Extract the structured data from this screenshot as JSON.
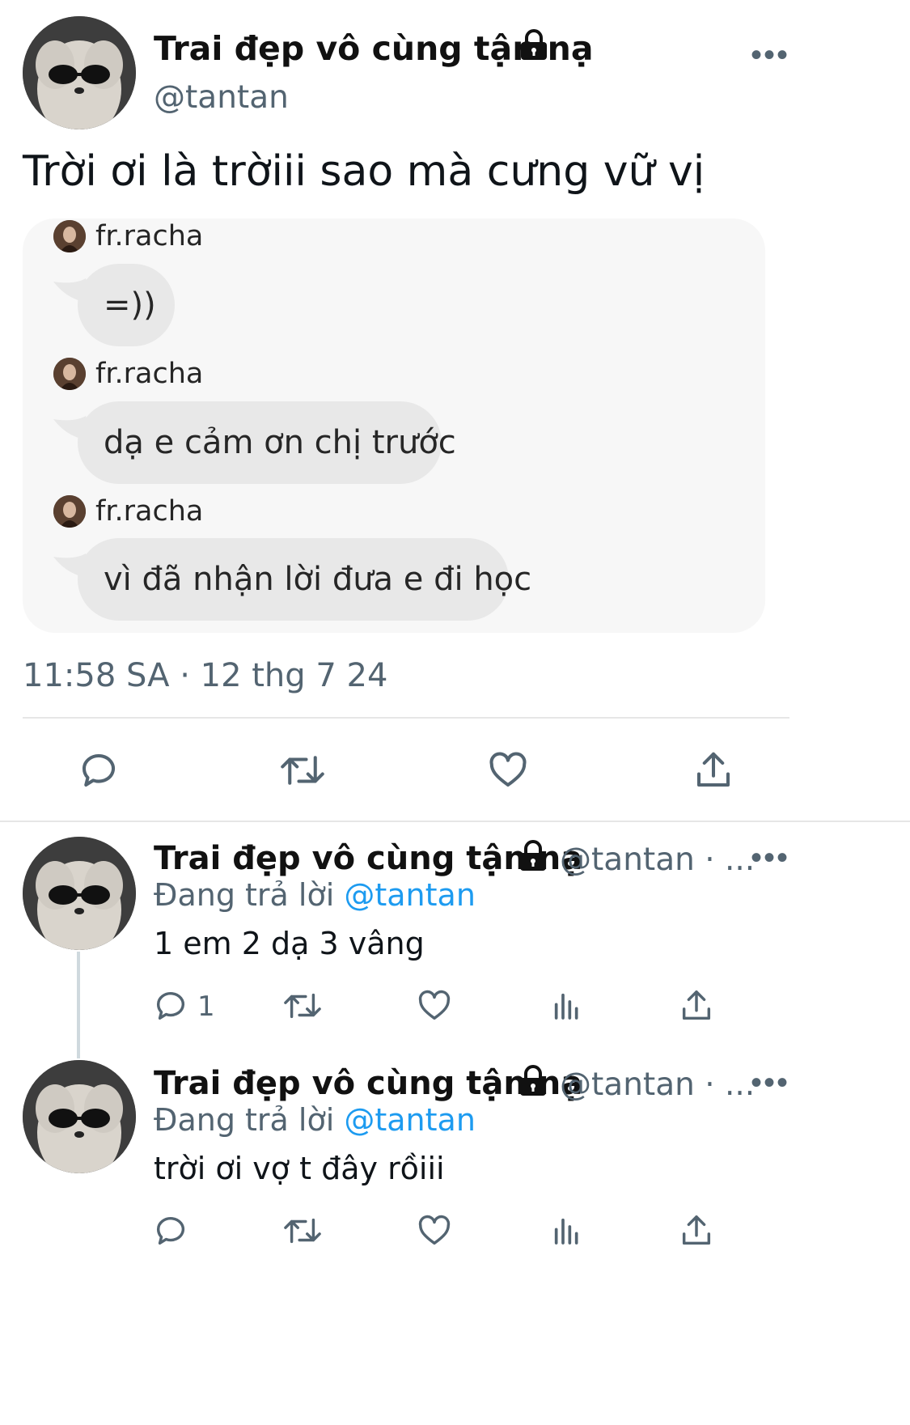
{
  "main_tweet": {
    "display_name": "Trai đẹp vô cùng tận nạ",
    "handle": "@tantan",
    "more_label": "•••",
    "text": "Trời ơi là trờiii sao mà cưng vữ vị",
    "timestamp": "11:58 SA · 12 thg 7 24",
    "chat": [
      {
        "sender": "fr.racha",
        "message": "=))"
      },
      {
        "sender": "fr.racha",
        "message": "dạ e cảm ơn chị trước"
      },
      {
        "sender": "fr.racha",
        "message": "vì đã nhận lời đưa e đi học"
      }
    ],
    "actions": [
      "reply-icon",
      "retweet-icon",
      "like-icon",
      "share-icon"
    ]
  },
  "replies": [
    {
      "display_name": "Trai đẹp vô cùng tận nạ",
      "handle_suffix": "@tantan · ...",
      "replying_prefix": "Đang trả lời",
      "replying_to": "@tantan",
      "text": "1 em 2 dạ 3 vâng",
      "reply_count": "1",
      "more_label": "•••"
    },
    {
      "display_name": "Trai đẹp vô cùng tận nạ",
      "handle_suffix": "@tantan · ...",
      "replying_prefix": "Đang trả lời",
      "replying_to": "@tantan",
      "text": "trời ơi vợ t đây rồiii",
      "reply_count": "",
      "more_label": "•••"
    }
  ],
  "colors": {
    "accent": "#1d9bf0",
    "secondary_text": "#536471",
    "bubble": "#e8e8e8",
    "card": "#f7f7f7"
  }
}
